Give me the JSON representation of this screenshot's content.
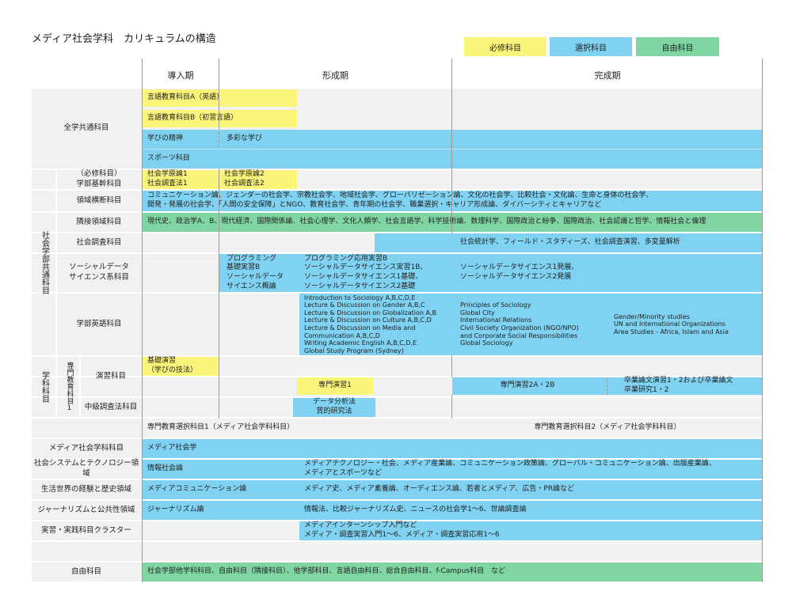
{
  "title": "メディア社会学科　カリキュラムの構造",
  "colors": {
    "required": "#fbf47a",
    "elective": "#7fd2f1",
    "free": "#7fd6a2",
    "row_bg": "#f1f1f1"
  },
  "legend": {
    "required": "必修科目",
    "elective": "選択科目",
    "free": "自由科目"
  },
  "periods": {
    "intro": "導入期",
    "formation": "形成期",
    "completion": "完成期"
  },
  "labels": {
    "zengaku": "全学共通科目",
    "kiso": "（必修科目）\n学部基幹科目",
    "ryouiki": "領域横断科目",
    "rinsetsu": "隣接領域科目",
    "chousa": "社会調査科目",
    "sds": "ソーシャルデータ\nサイエンス系科目",
    "eigo": "学部英語科目",
    "gakubu_vertical": "社会学部共通科目",
    "gakka_vertical": "学科科目",
    "senmon_vertical": "専門教育科目1",
    "enshu": "演習科目",
    "chukyu": "中級調査法科目",
    "media": "メディア社会学科科目",
    "system": "社会システムとテクノロジー領域",
    "seikatsu": "生活世界の経験と歴史領域",
    "journalism": "ジャーナリズムと公共性領域",
    "jisshu": "実習・実践科目クラスター",
    "jiyu": "自由科目"
  },
  "cells": {
    "gengo_a": "言語教育科目A（英語）",
    "gengo_b": "言語教育科目B（初習言語）",
    "manabi": "学びの精神",
    "tasai": "多彩な学び",
    "sports": "スポーツ科目",
    "kiso1": "社会学原論1\n社会調査法1",
    "kiso2": "社会学原論2\n社会調査法2",
    "ryouiki": "コミュニケーション論、ジェンダーの社会学、宗教社会学、地域社会学、グローバリゼーション論、文化の社会学、比較社会・文化論、生命と身体の社会学、\n開発・発展の社会学、「人間の安全保障」とNGO、教育社会学、青年期の社会学、職業選択・キャリア形成論、ダイバーシティとキャリアなど",
    "rinsetsu": "現代史、政治学A、B、現代経済、国際関係論、社会心理学、文化人類学、社会言語学、科学技術論、数理科学、国際政治と紛争、国際政治、社会認識と哲学、情報社会と倫理",
    "chousa": "社会統計学、フィールド・スタディーズ、社会調査演習、多変量解析",
    "sds1": "プログラミング\n基礎実習B\nソーシャルデータ\nサイエンス概論",
    "sds2": "プログラミング応用実習B\nソーシャルデータサイエンス実習1B、\nソーシャルデータサイエンス1基礎、\nソーシャルデータサイエンス2基礎",
    "sds3": "ソーシャルデータサイエンス1発展、\nソーシャルデータサイエンス2発展",
    "eigo1": "Introduction to Sociology A,B,C,D,E\nLecture & Discussion on Gender A,B,C\nLecture & Discussion on Globalization A,B\nLecture & Discussion on Culture A,B,C,D\nLecture & Discussion on Media and\nCommunication A,B,C,D\nWriting Academic English A,B,C,D,E\nGlobal Study Program (Sydney)",
    "eigo2": "Principles of Sociology\nGlobal City\nInternational Relations\nCivil Society Organization (NGO/NPO)\nand Corporate Social Responsibilities\nGlobal Sociology",
    "eigo3": "Gender/Minority studies\nUN and International Organizations\nArea Studies - Africa, Islam and Asia",
    "kiso_enshu": "基礎演習\n（学びの技法）",
    "senmon1": "専門演習1",
    "senmon2": "専門演習2A・2B",
    "sotsuron": "卒業論文演習1・2および卒業論文\n卒業研究1・2",
    "data": "データ分析法\n質的研究法",
    "senmon_sentaku1": "専門教育選択科目1（メディア社会学科科目）",
    "senmon_sentaku2": "専門教育選択科目2（メディア社会学科科目）",
    "media": "メディア社会学",
    "jouhou": "情報社会論",
    "system": "メディアテクノロジー・社会、メディア産業論、コミュニケーション政策論、グローバル・コミュニケーション論、出版産業論、\nメディアとスポーツなど",
    "media_comm": "メディアコミュニケーション論",
    "seikatsu": "メディア史、メディア素養論、オーディエンス論、若者とメディア、広告・PR論など",
    "journalism": "ジャーナリズム論",
    "journalism2": "情報法、比較ジャーナリズム史、ニュースの社会学1～6、世論調査論",
    "jisshu": "メディアインターンシップ入門など\nメディア・調査実習入門1～6、メディア・調査実習応用1～6",
    "jiyu": "社会学部他学科科目、自由科目（隣接科目）、他学部科目、言語自由科目、総合自由科目、f-Campus科目　など"
  }
}
